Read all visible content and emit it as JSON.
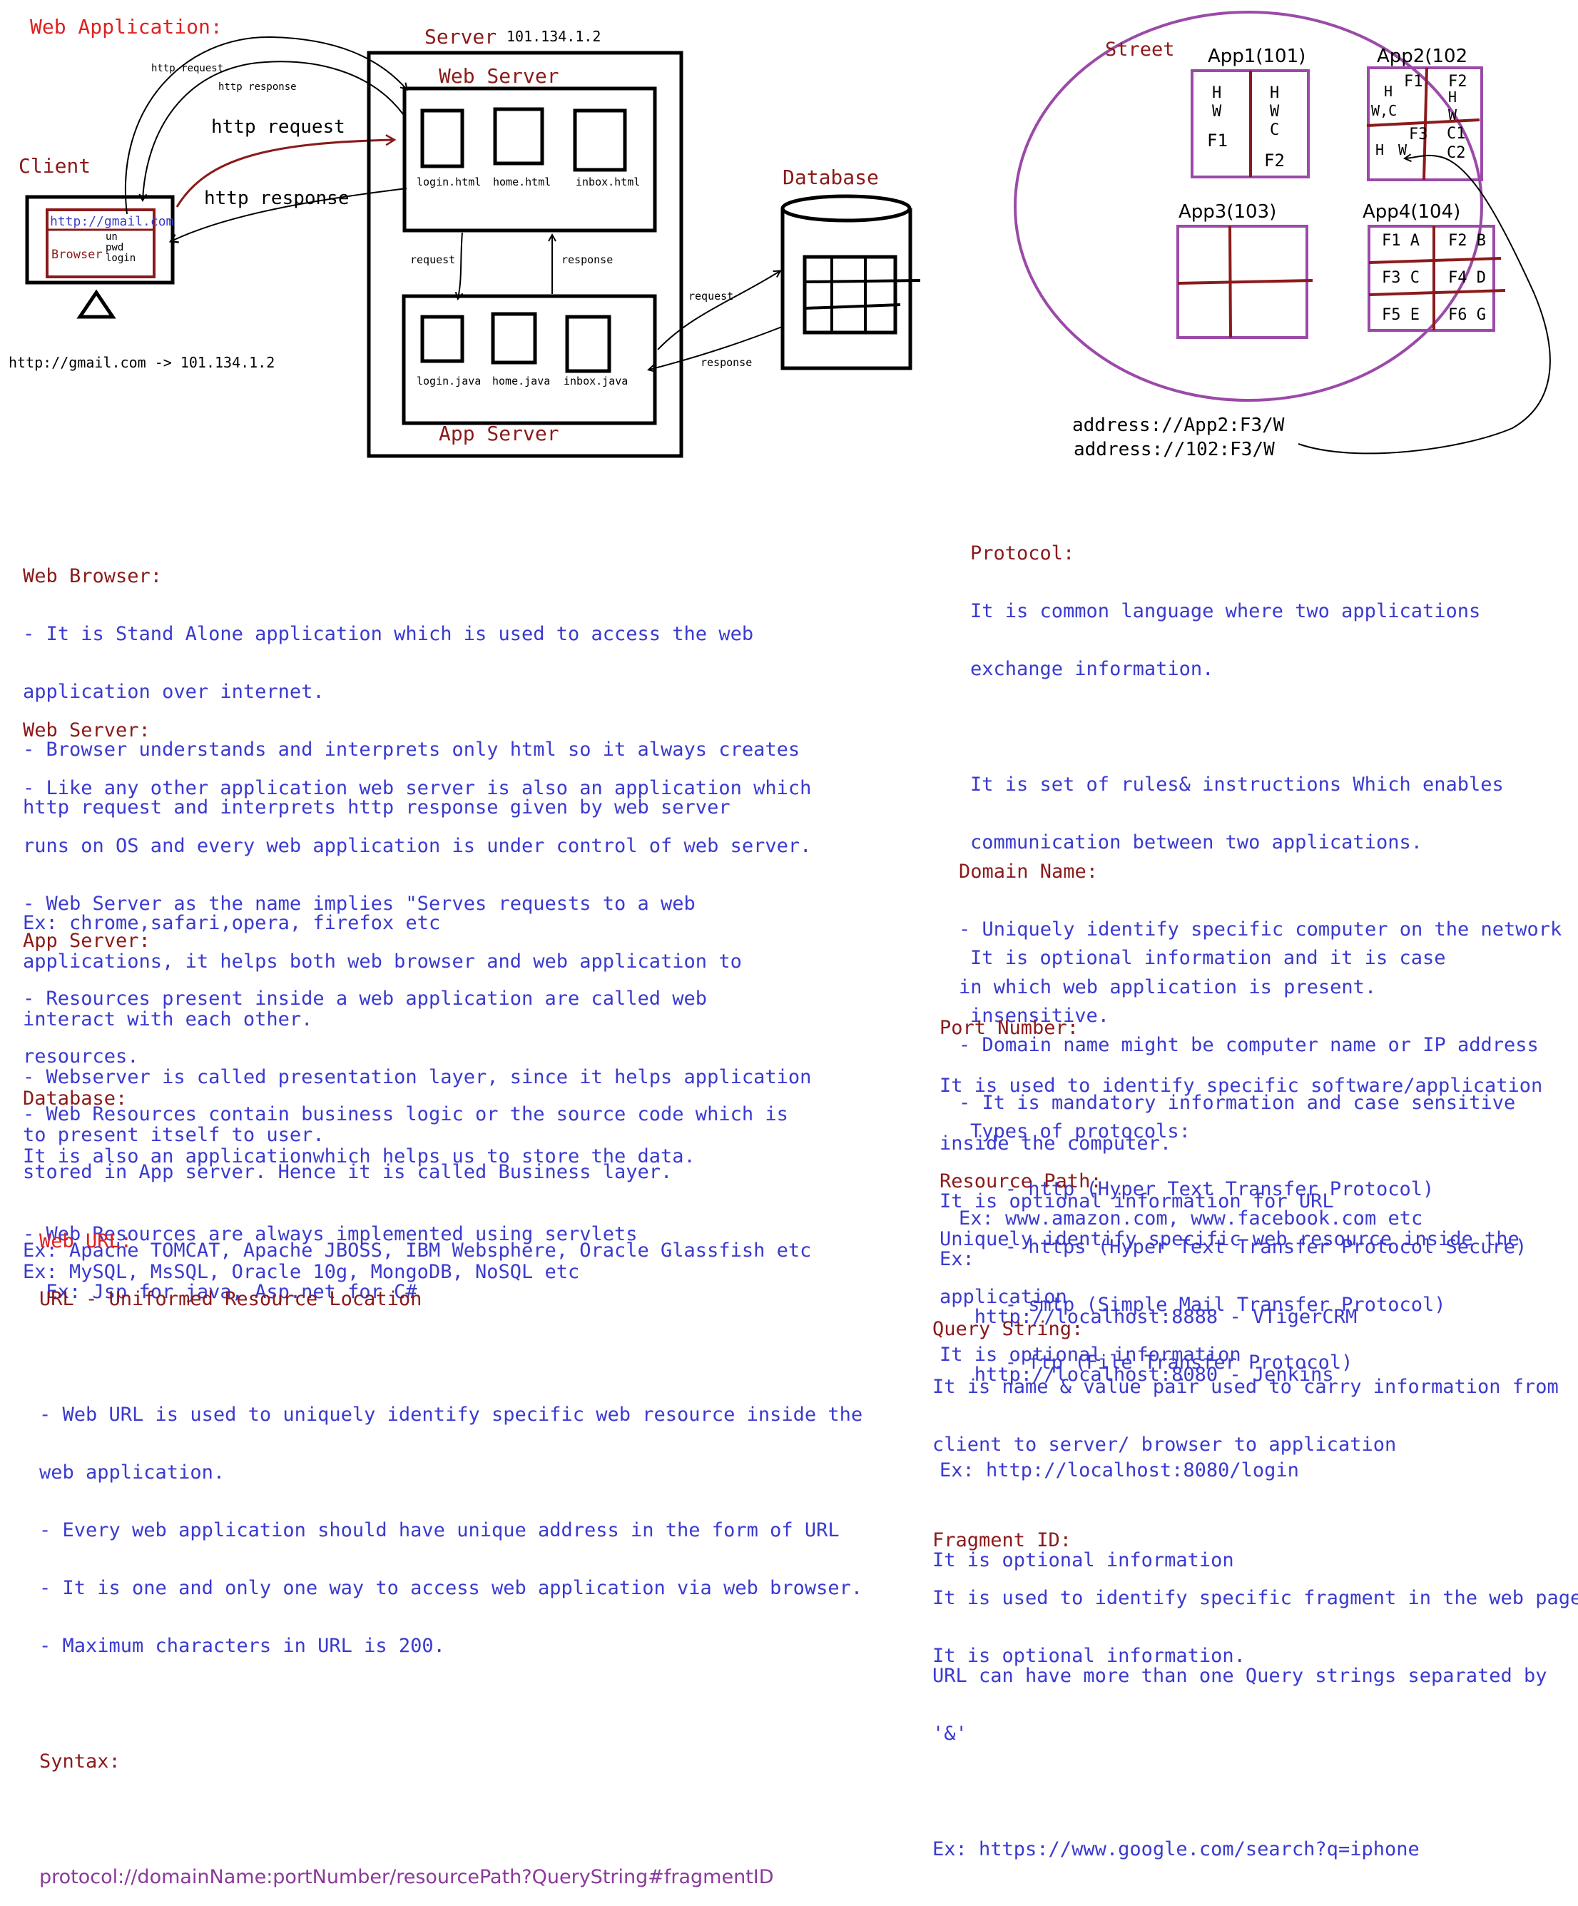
{
  "diagram": {
    "title": "Web Application:",
    "client": {
      "label": "Client",
      "url": "http://gmail.com",
      "browser": "Browser",
      "fields": [
        "un",
        "pwd",
        "login"
      ]
    },
    "server": {
      "label": "Server",
      "ip": "101.134.1.2",
      "web_server": "Web Server",
      "app_server": "App Server",
      "html_files": [
        "login.html",
        "home.html",
        "inbox.html"
      ],
      "java_files": [
        "login.java",
        "home.java",
        "inbox.java"
      ]
    },
    "arrows": {
      "http_request_small": "http request",
      "http_response_small": "http response",
      "http_request": "http request",
      "http_response": "http response",
      "request": "request",
      "response": "response"
    },
    "database": "Database",
    "dns": "http://gmail.com -> 101.134.1.2",
    "street": {
      "label": "Street",
      "app1": "App1(101)",
      "app2": "App2(102",
      "app3": "App3(103)",
      "app4": "App4(104)",
      "app1_left": [
        "H",
        "W",
        "F1"
      ],
      "app1_right": [
        "H",
        "W",
        "C",
        "F2"
      ],
      "app2_cells": [
        "F1",
        "F2",
        "H",
        "H",
        "W,C",
        "W",
        "F3",
        "C1",
        "H",
        "W",
        "C2"
      ],
      "app4_cells": [
        "F1 A",
        "F2 B",
        "F3 C",
        "F4 D",
        "F5 E",
        "F6 G"
      ],
      "address1": "address://App2:F3/W",
      "address2": "address://102:F3/W"
    }
  },
  "notes": {
    "web_browser": {
      "heading": "Web Browser:",
      "lines": [
        "- It is Stand Alone application which is used to access the web",
        "application over internet.",
        "- Browser understands and interprets only html so it always creates",
        "http request and interprets http response given by web server"
      ],
      "example": "Ex: chrome,safari,opera, firefox etc"
    },
    "web_server": {
      "heading": "Web Server:",
      "lines": [
        "- Like any other application web server is also an application which",
        "runs on OS and every web application is under control of web server.",
        "- Web Server as the name implies \"Serves requests to a web",
        "applications, it helps both web browser and web application to",
        "interact with each other.",
        "- Webserver is called presentation layer, since it helps application",
        "to present itself to user."
      ],
      "example": "Ex: Apache TOMCAT, Apache JBOSS, IBM Websphere, Oracle Glassfish etc"
    },
    "app_server": {
      "heading": "App Server:",
      "lines": [
        "- Resources present inside a web application are called web",
        "resources.",
        "- Web Resources contain business logic or the source code which is",
        "stored in App server. Hence it is called Business layer."
      ],
      "lines2": [
        "- Web Resources are always implemented using servlets",
        "  Ex: Jsp for java, Asp.net for C#"
      ]
    },
    "database": {
      "heading": "Database:",
      "lines": [
        "It is also an applicationwhich helps us to store the data."
      ],
      "example": "Ex: MySQL, MsSQL, Oracle 10g, MongoDB, NoSQL etc"
    },
    "web_url": {
      "heading": "Web URL:",
      "heading2": "URL - Uniformed Resource Location",
      "lines": [
        "- Web URL is used to uniquely identify specific web resource inside the",
        "web application.",
        "- Every web application should have unique address in the form of URL",
        "- It is one and only one way to access web application via web browser.",
        "- Maximum characters in URL is 200."
      ],
      "syntax_label": "Syntax:",
      "syntax": "protocol://domainName:portNumber/resourcePath?QueryString#fragmentID"
    },
    "protocol": {
      "heading": "Protocol:",
      "p1": [
        "It is common language where two applications",
        "exchange information."
      ],
      "p2": [
        "It is set of rules& instructions Which enables",
        "communication between two applications."
      ],
      "p3": [
        "It is optional information and it is case",
        "insensitive."
      ],
      "types_label": "Types of protocols:",
      "types": [
        "   - http (Hyper Text Transfer Protocol)",
        "   - https (Hyper Text Transfer Protocol Secure)",
        "   - smtp (Simple Mail Transfer Protocol)",
        "   - ftp (File Transfer Protocol)"
      ]
    },
    "domain_name": {
      "heading": "Domain Name:",
      "lines": [
        "- Uniquely identify specific computer on the network",
        "in which web application is present.",
        "- Domain name might be computer name or IP address",
        "- It is mandatory information and case sensitive"
      ],
      "example": "Ex: www.amazon.com, www.facebook.com etc"
    },
    "port_number": {
      "heading": "Port Number:",
      "lines": [
        "It is used to identify specific software/application",
        "inside the computer.",
        "It is optional information for URL",
        "Ex:",
        "   http://localhost:8888 - VTigerCRM",
        "   http://localhost:8080 - Jenkins"
      ]
    },
    "resource_path": {
      "heading": "Resource Path:",
      "lines": [
        "Uniquely identify specific web resource inside the",
        "application",
        "It is optional information"
      ],
      "example": "Ex: http://localhost:8080/login"
    },
    "query_string": {
      "heading": "Query String:",
      "p1": [
        "It is name & value pair used to carry information from",
        "client to server/ browser to application"
      ],
      "p2": [
        "It is optional information"
      ],
      "p3": [
        "URL can have more than one Query strings separated by",
        "'&'"
      ],
      "example": "Ex: https://www.google.com/search?q=iphone"
    },
    "fragment_id": {
      "heading": "Fragment ID:",
      "lines": [
        "It is used to identify specific fragment in the web page",
        "It is optional information."
      ]
    }
  }
}
